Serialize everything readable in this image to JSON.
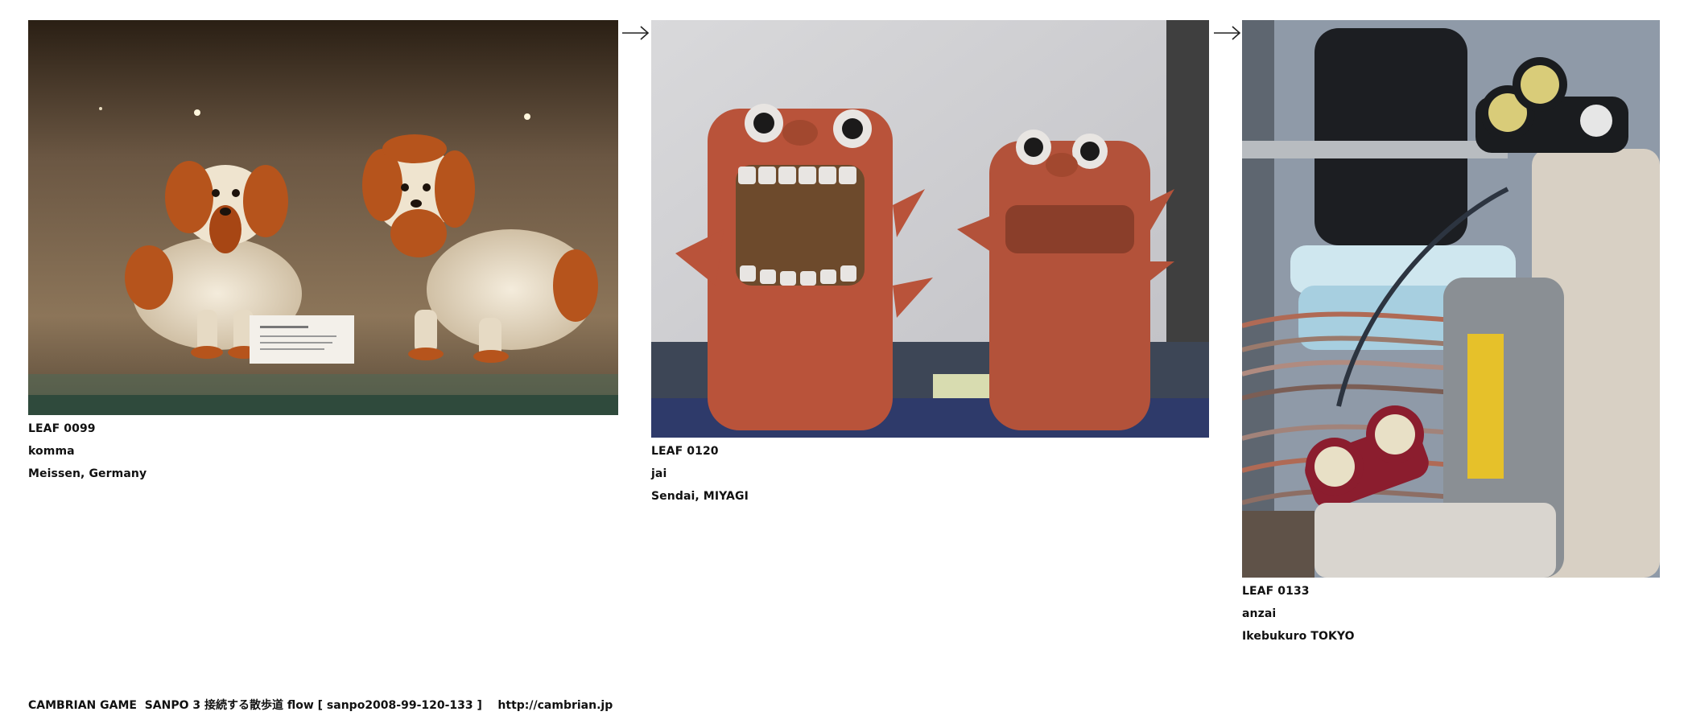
{
  "leaves": [
    {
      "id": "LEAF 0099",
      "name": "komma",
      "place": "Meissen, Germany"
    },
    {
      "id": "LEAF 0120",
      "name": "jai",
      "place": "Sendai, MIYAGI"
    },
    {
      "id": "LEAF 0133",
      "name": "anzai",
      "place": "Ikebukuro TOKYO"
    }
  ],
  "connector_icon": "right-arrow-icon",
  "footer": {
    "text": "CAMBRIAN GAME  SANPO 3 接続する散歩道 flow [ sanpo2008-99-120-133 ]    http://cambrian.jp"
  }
}
